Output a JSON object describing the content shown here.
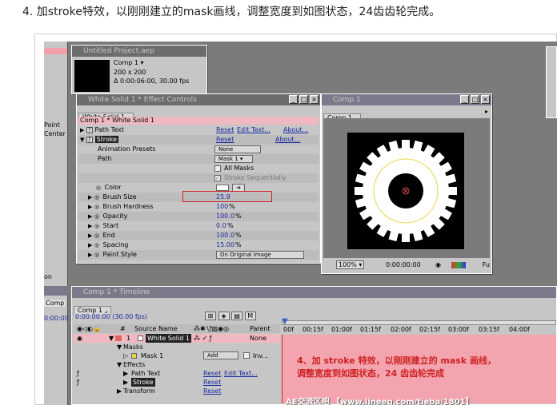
{
  "caption": "4. 加stroke特效，以刚刚建立的mask画线，调整宽度到如图状态，24齿齿轮完成。",
  "left_panel": {
    "labels": [
      "Point",
      "Center",
      "on"
    ],
    "comp_tab": "Comp",
    "time": "0:00:00"
  },
  "project": {
    "title": "Untitled Project.aep",
    "comp_name": "Comp 1 ▾",
    "size": "200 x 200",
    "duration": "Δ 0:00:06:00, 30.00 fps"
  },
  "effect_controls": {
    "title": "White Solid 1 * Effect Controls",
    "tab": "White Solid 1 ⌟",
    "breadcrumb": "Comp 1 * White Solid 1",
    "rows": [
      {
        "name": "Path Text",
        "reset": "Reset",
        "extra": "Edit Text...",
        "about": "About..."
      },
      {
        "name": "Stroke",
        "reset": "Reset",
        "about": "About..."
      },
      {
        "name": "Animation Presets",
        "value": "None"
      },
      {
        "name": "Path",
        "value": "Mask 1 ▾"
      },
      {
        "name": "All Masks"
      },
      {
        "name": "Stroke Sequentially"
      },
      {
        "name": "Color"
      },
      {
        "name": "Brush Size",
        "value": "25.9"
      },
      {
        "name": "Brush Hardness",
        "value": "100",
        "unit": "%"
      },
      {
        "name": "Opacity",
        "value": "100.0",
        "unit": "%"
      },
      {
        "name": "Start",
        "value": "0.0",
        "unit": "%"
      },
      {
        "name": "End",
        "value": "100.0",
        "unit": "%"
      },
      {
        "name": "Spacing",
        "value": "15.00",
        "unit": "%"
      },
      {
        "name": "Paint Style",
        "value": "On Original Image"
      }
    ]
  },
  "comp_viewer": {
    "title": "Comp 1",
    "tab": "Comp 1 ⌟",
    "zoom": "100% ▾",
    "time": "0:00:00:00",
    "right": "Fu"
  },
  "timeline": {
    "title": "Comp 1 * Timeline",
    "tab": "Comp 1 ⌟",
    "time": "0:00:00:00 (30.00 fps)",
    "col_source": "Source Name",
    "col_parent": "Parent",
    "ruler": [
      "00f",
      "00:15f",
      "01:00f",
      "01:15f",
      "02:00f",
      "02:15f",
      "03:00f",
      "03:15f",
      "04:00f"
    ],
    "layers": [
      {
        "num": "1",
        "name": "White Solid 1",
        "parent": "None"
      },
      {
        "name": "Masks"
      },
      {
        "name": "Mask 1",
        "mode": "Add",
        "inv": "Inv..."
      },
      {
        "name": "Effects"
      },
      {
        "name": "Path Text",
        "reset": "Reset",
        "extra": "Edit Text..."
      },
      {
        "name": "Stroke",
        "reset": "Reset"
      },
      {
        "name": "Transform",
        "reset": "Reset"
      }
    ]
  },
  "overlay": {
    "line1": "4、加 stroke 特效，以刚刚建立的 mask 画线，",
    "line2": "调整宽度到如图状态，24 齿齿轮完成"
  },
  "watermark": "AE交流区吧 【www.lineeg.com/tieba/1801】",
  "colors": {
    "accent": "#cc2222",
    "bg": "#7b7b7b",
    "panel": "#c6c6c6",
    "link": "#1a2aa0"
  }
}
